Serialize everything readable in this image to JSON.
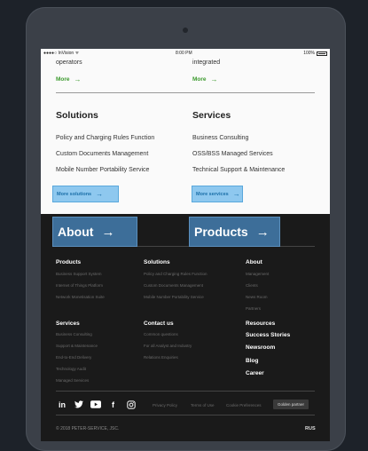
{
  "statusbar": {
    "carrier": "●●●●○ InVision ᯤ",
    "time": "8:00 PM",
    "battery": "100%"
  },
  "top": {
    "col1_text": "operators",
    "col2_text": "integrated",
    "more_label": "More",
    "arrow": "→"
  },
  "solutions": {
    "title": "Solutions",
    "items": [
      "Policy and Charging Rules Function",
      "Custom Documents Management",
      "Mobile Number Portability Service"
    ],
    "button": "More solutions"
  },
  "services": {
    "title": "Services",
    "items": [
      "Business Consulting",
      "OSS/BSS Managed Services",
      "Technical Support & Maintenance"
    ],
    "button": "More services"
  },
  "big_buttons": {
    "about": "About",
    "products": "Products",
    "arrow": "→"
  },
  "footer": {
    "products": {
      "title": "Products",
      "links": [
        "Business Support System",
        "Internet of Things Platform",
        "Network Monetisation Suite"
      ]
    },
    "solutions": {
      "title": "Solutions",
      "links": [
        "Policy and Charging Rules Function",
        "Custom Documents Management",
        "Mobile Number Portability Service"
      ]
    },
    "about": {
      "title": "About",
      "links": [
        "Management",
        "Clients",
        "News Room",
        "Partners"
      ]
    },
    "services": {
      "title": "Services",
      "links": [
        "Business Consulting",
        "Support & Maintenance",
        "End-to-End Delivery",
        "Technology Audit",
        "Managed Services"
      ]
    },
    "contact": {
      "title": "Contact us",
      "links": [
        "Common questions",
        "For all Analyst and Industry",
        "Relations Enquiries"
      ]
    },
    "resources": {
      "title": "Resources",
      "links": [
        "Success Stories",
        "Newsroom",
        "Blog",
        "Career"
      ]
    },
    "social": {
      "linkedin": "in",
      "twitter": "🐦",
      "youtube": "▶",
      "facebook": "f",
      "instagram": "◎"
    },
    "legal": {
      "privacy": "Privacy Policy",
      "terms": "Terms of Use",
      "cookie": "Cookie Preferences"
    },
    "badge": "Golden partner",
    "copyright": "© 2018 PETER-SERVICE, JSC.",
    "lang": "RUS"
  },
  "colors": {
    "accent_green": "#3c9a2e",
    "button_blue": "#3d6e99",
    "light_button": "#8ec8ef",
    "dark_bg": "#1a1a1a"
  }
}
